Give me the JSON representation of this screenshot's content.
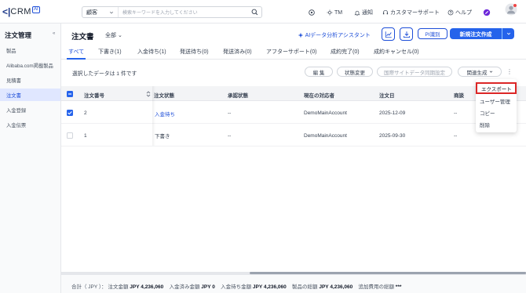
{
  "app": {
    "logo_mark": "<|",
    "logo_text": "CRM",
    "logo_badge": "AI"
  },
  "search": {
    "scope": "顧客",
    "placeholder": "検索キーワードを入力してください"
  },
  "topbar": {
    "user": "TM",
    "notifications": "通知",
    "support": "カスタマーサポート",
    "help": "ヘルプ",
    "avatar_badge": "TM"
  },
  "sidebar": {
    "title": "注文管理",
    "collapse": "«",
    "items": [
      {
        "label": "製品"
      },
      {
        "label": "Alibaba.com掲載製品"
      },
      {
        "label": "見積書"
      },
      {
        "label": "注文書"
      },
      {
        "label": "入金登録"
      },
      {
        "label": "入金伝票"
      }
    ]
  },
  "header": {
    "title": "注文書",
    "filter": "全部 ⌄",
    "ai_assistant": "AIデータ分析アシスタント",
    "pi_button": "PI識別",
    "new_order": "新規注文作成"
  },
  "tabs": [
    {
      "label": "すべて"
    },
    {
      "label": "下書き(1)"
    },
    {
      "label": "入金待ち(1)"
    },
    {
      "label": "発送待ち(0)"
    },
    {
      "label": "発送済み(0)"
    },
    {
      "label": "アフターサポート(0)"
    },
    {
      "label": "成約完了(0)"
    },
    {
      "label": "成約キャンセル(0)"
    }
  ],
  "actions": {
    "selected_text": "選択したデータは 1 件です",
    "edit": "編 集",
    "status_change": "状態変更",
    "sync": "国際サイトデータ同期設定",
    "related": "関連生成",
    "more": "⋮"
  },
  "table": {
    "columns": [
      "注文番号",
      "注文状態",
      "承認状態",
      "現在の対応者",
      "注文日",
      "商談"
    ],
    "rows": [
      {
        "number": "2",
        "status": "入金待ち",
        "approval": "--",
        "owner": "DemoMainAccount",
        "date": "2025-12-09",
        "deal": "--",
        "checked": true
      },
      {
        "number": "1",
        "status": "下書き",
        "approval": "--",
        "owner": "DemoMainAccount",
        "date": "2025-09-30",
        "deal": "--",
        "checked": false
      }
    ]
  },
  "menu": {
    "items": [
      {
        "label": "エクスポート"
      },
      {
        "label": "ユーザー管理"
      },
      {
        "label": "コピー"
      },
      {
        "label": "削除"
      }
    ]
  },
  "footer": {
    "prefix": "合計（ JPY ）：",
    "order_total_label": "注文金額",
    "order_total": "JPY 4,236,060",
    "paid_label": "入金済み金額",
    "paid": "JPY 0",
    "pending_label": "入金待ち金額",
    "pending": "JPY 4,236,060",
    "product_label": "製品の総額",
    "product": "JPY 4,236,060",
    "extra_label": "追加費用の総額",
    "extra": "***"
  },
  "colors": {
    "accent": "#2563eb",
    "highlight": "#dc2626"
  }
}
